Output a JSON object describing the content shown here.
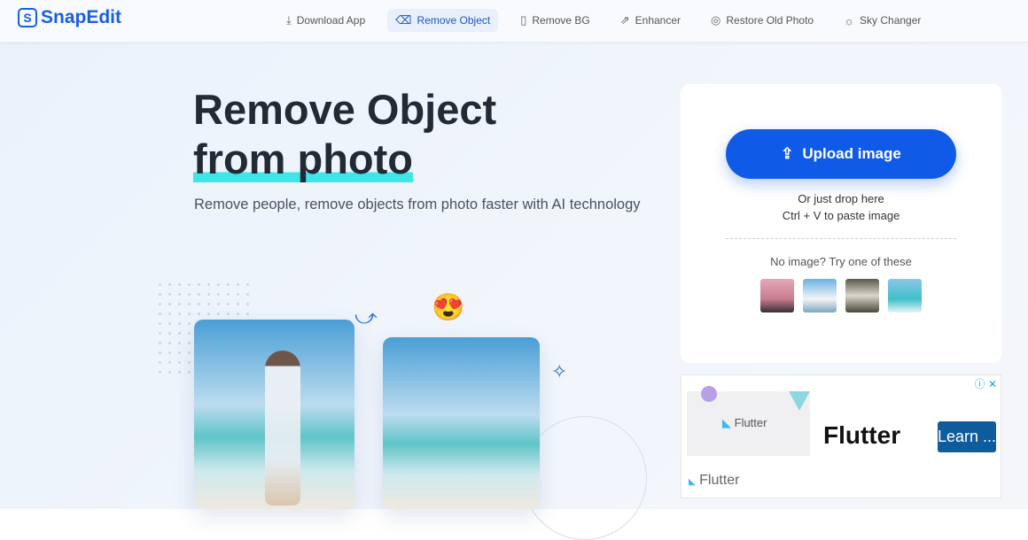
{
  "brand": {
    "name": "SnapEdit",
    "mark": "S"
  },
  "nav": {
    "items": [
      {
        "label": "Download App",
        "icon": "download-icon",
        "glyph": "⤓"
      },
      {
        "label": "Remove Object",
        "icon": "eraser-icon",
        "glyph": "⌫",
        "active": true
      },
      {
        "label": "Remove BG",
        "icon": "remove-bg-icon",
        "glyph": "▯"
      },
      {
        "label": "Enhancer",
        "icon": "enhance-icon",
        "glyph": "⇗"
      },
      {
        "label": "Restore Old Photo",
        "icon": "restore-icon",
        "glyph": "◎"
      },
      {
        "label": "Sky Changer",
        "icon": "sky-icon",
        "glyph": "☼"
      }
    ]
  },
  "hero": {
    "title_line1": "Remove Object",
    "title_line2": "from photo",
    "subtitle": "Remove people, remove objects from photo faster with AI technology",
    "emoji": "😍"
  },
  "upload": {
    "button": "Upload image",
    "drop_hint": "Or just drop here",
    "paste_hint": "Ctrl + V to paste image",
    "no_image": "No image? Try one of these"
  },
  "ad": {
    "image_text": "Flutter",
    "title": "Flutter",
    "cta": "Learn ...",
    "footer": "Flutter",
    "controls": "ⓘ ✕"
  },
  "colors": {
    "accent": "#0f5be8",
    "highlight": "#3ee6ea",
    "ad_cta": "#0e5b9e"
  }
}
